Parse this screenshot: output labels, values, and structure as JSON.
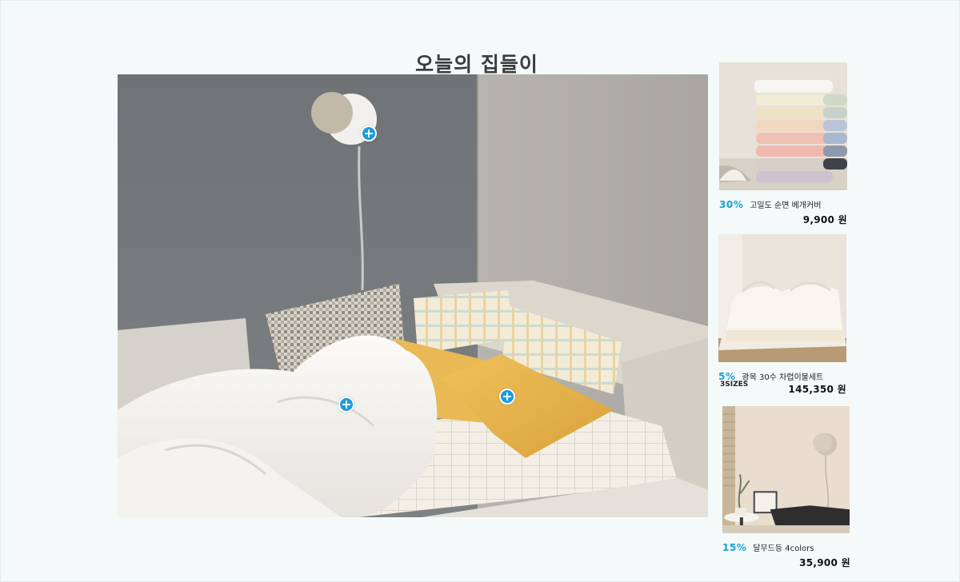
{
  "page": {
    "title": "오늘의 집들이"
  },
  "products": [
    {
      "discount": "30%",
      "name": "고밀도 순면 베개커버",
      "price": "9,900 원"
    },
    {
      "discount": "5%",
      "name": "광목 30수 차렵이불세트",
      "subtitle": "3SIZES",
      "price": "145,350 원"
    },
    {
      "discount": "15%",
      "name": "달무드등 4colors",
      "price": "35,900 원"
    }
  ],
  "icons": {
    "hotspot": "plus-circle-icon"
  },
  "colors": {
    "accent": "#17a3d8",
    "hotspot": "#1a9be0",
    "background": "#f4f9f9"
  }
}
